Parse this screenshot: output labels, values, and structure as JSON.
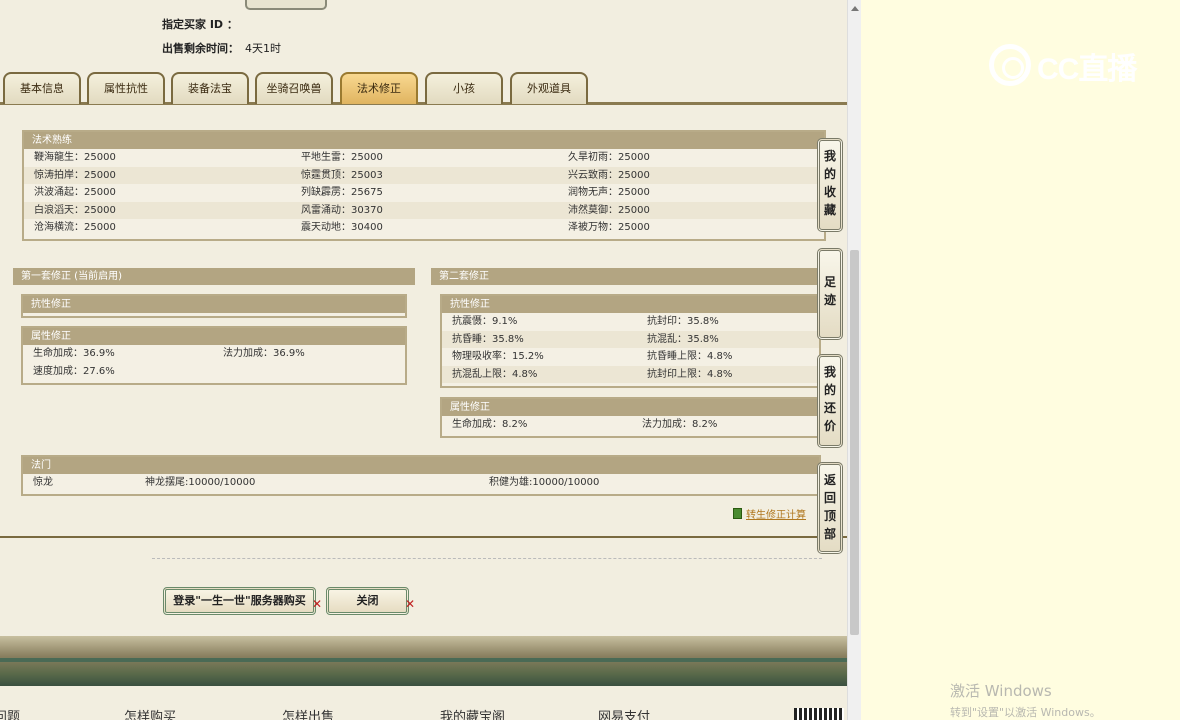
{
  "header": {
    "buyer_id_label": "指定买家 ID ：",
    "time_label": "出售剩余时间：",
    "time_value": "4天1时"
  },
  "tabs": [
    {
      "label": "基本信息",
      "active": false
    },
    {
      "label": "属性抗性",
      "active": false
    },
    {
      "label": "装备法宝",
      "active": false
    },
    {
      "label": "坐骑召唤兽",
      "active": false
    },
    {
      "label": "法术修正",
      "active": true
    },
    {
      "label": "小孩",
      "active": false
    },
    {
      "label": "外观道具",
      "active": false
    }
  ],
  "spell_mastery": {
    "title": "法术熟练",
    "rows": [
      [
        "鞭海龍生：25000",
        "平地生雷：25000",
        "久旱初雨：25000"
      ],
      [
        "惊涛拍岸：25000",
        "惊霆贯顶：25003",
        "兴云致雨：25000"
      ],
      [
        "洪波涌起：25000",
        "列缺霹雳：25675",
        "润物无声：25000"
      ],
      [
        "白浪滔天：25000",
        "风雷涌动：30370",
        "沛然莫御：25000"
      ],
      [
        "沧海横流：25000",
        "震天动地：30400",
        "泽被万物：25000"
      ]
    ]
  },
  "set1": {
    "title": "第一套修正 (当前启用)",
    "resist_title": "抗性修正",
    "attr_title": "属性修正",
    "attr_rows": [
      [
        "生命加成：36.9%",
        "法力加成：36.9%"
      ],
      [
        "速度加成：27.6%",
        ""
      ]
    ]
  },
  "set2": {
    "title": "第二套修正",
    "resist_title": "抗性修正",
    "resist_rows": [
      [
        "抗震慑：9.1%",
        "抗封印：35.8%"
      ],
      [
        "抗昏睡：35.8%",
        "抗混乱：35.8%"
      ],
      [
        "物理吸收率：15.2%",
        "抗昏睡上限：4.8%"
      ],
      [
        "抗混乱上限：4.8%",
        "抗封印上限：4.8%"
      ]
    ],
    "attr_title": "属性修正",
    "attr_rows": [
      [
        "生命加成：8.2%",
        "法力加成：8.2%"
      ]
    ]
  },
  "school": {
    "title": "法门",
    "cells": [
      "惊龙",
      "神龙摆尾:10000/10000",
      "积健为雄:10000/10000"
    ]
  },
  "recalc_link": "转生修正计算",
  "buttons": {
    "login_buy": "登录\"一生一世\"服务器购买",
    "close": "关闭"
  },
  "side_buttons": [
    "我的收藏",
    "足迹",
    "我的还价",
    "返回顶部"
  ],
  "footer_nav": [
    "问题",
    "怎样购买",
    "怎样出售",
    "我的藏宝阁",
    "网易支付"
  ],
  "watermark": {
    "logo": "CC直播",
    "activate_title": "激活 Windows",
    "activate_sub": "转到\"设置\"以激活 Windows。"
  }
}
